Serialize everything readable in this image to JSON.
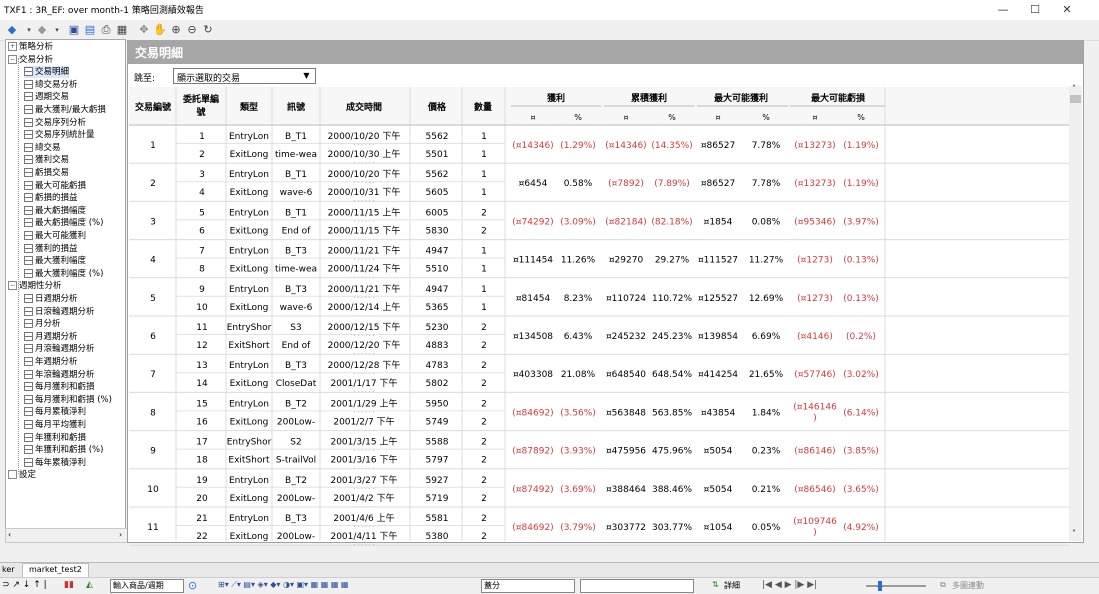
{
  "window": {
    "title": "TXF1 : 3R_EF: over month-1 策略回測績效報告",
    "controls": {
      "minimize": "—",
      "maximize": "☐",
      "close": "✕"
    }
  },
  "toolbar": {
    "icons": [
      "back-icon",
      "forward-icon",
      "save-icon",
      "doc-icon",
      "print-icon",
      "toggle-icon",
      "pointer-icon",
      "hand-icon",
      "zoom-in-icon",
      "zoom-out-icon",
      "refresh-icon"
    ]
  },
  "tree": {
    "nodes": [
      {
        "label": "策略分析",
        "level": 0,
        "box": "⊞",
        "selected": false
      },
      {
        "label": "交易分析",
        "level": 0,
        "box": "⊟",
        "selected": false
      },
      {
        "label": "交易明細",
        "level": 1,
        "selected": true
      },
      {
        "label": "總交易分析",
        "level": 1,
        "selected": false
      },
      {
        "label": "週期交易",
        "level": 1,
        "selected": false
      },
      {
        "label": "最大獲利/最大虧損",
        "level": 1,
        "selected": false
      },
      {
        "label": "交易序列分析",
        "level": 1,
        "selected": false
      },
      {
        "label": "交易序列統計量",
        "level": 1,
        "selected": false
      },
      {
        "label": "總交易",
        "level": 1,
        "selected": false
      },
      {
        "label": "獲利交易",
        "level": 1,
        "selected": false
      },
      {
        "label": "虧損交易",
        "level": 1,
        "selected": false
      },
      {
        "label": "最大可能虧損",
        "level": 1,
        "selected": false
      },
      {
        "label": "虧損的損益",
        "level": 1,
        "selected": false
      },
      {
        "label": "最大虧損幅度",
        "level": 1,
        "selected": false
      },
      {
        "label": "最大虧損幅度 (%)",
        "level": 1,
        "selected": false
      },
      {
        "label": "最大可能獲利",
        "level": 1,
        "selected": false
      },
      {
        "label": "獲利的損益",
        "level": 1,
        "selected": false
      },
      {
        "label": "最大獲利幅度",
        "level": 1,
        "selected": false
      },
      {
        "label": "最大獲利幅度 (%)",
        "level": 1,
        "selected": false
      },
      {
        "label": "週期性分析",
        "level": 0,
        "box": "⊟",
        "selected": false
      },
      {
        "label": "日週期分析",
        "level": 1,
        "selected": false
      },
      {
        "label": "日滾輪週期分析",
        "level": 1,
        "selected": false
      },
      {
        "label": "月分析",
        "level": 1,
        "selected": false
      },
      {
        "label": "月週期分析",
        "level": 1,
        "selected": false
      },
      {
        "label": "月滾輪週期分析",
        "level": 1,
        "selected": false
      },
      {
        "label": "年週期分析",
        "level": 1,
        "selected": false
      },
      {
        "label": "年滾輪週期分析",
        "level": 1,
        "selected": false
      },
      {
        "label": "每月獲利和虧損",
        "level": 1,
        "selected": false
      },
      {
        "label": "每月獲利和虧損 (%)",
        "level": 1,
        "selected": false
      },
      {
        "label": "每月累積淨利",
        "level": 1,
        "selected": false
      },
      {
        "label": "每月平均獲利",
        "level": 1,
        "selected": false
      },
      {
        "label": "年獲利和虧損",
        "level": 1,
        "selected": false
      },
      {
        "label": "年獲利和虧損 (%)",
        "level": 1,
        "selected": false
      },
      {
        "label": "每年累積淨利",
        "level": 1,
        "selected": false
      },
      {
        "label": "設定",
        "level": 0,
        "box": "",
        "selected": false
      }
    ]
  },
  "panel": {
    "title": "交易明細",
    "jump_label": "跳至:",
    "jump_value": "顯示選取的交易",
    "headers": {
      "trade_no": "交易編號",
      "order_no": "委託單編號",
      "type": "類型",
      "signal": "訊號",
      "time": "成交時間",
      "price": "價格",
      "qty": "數量",
      "profit": "獲利",
      "cum_profit": "累積獲利",
      "max_profit": "最大可能獲利",
      "max_loss": "最大可能虧損",
      "currency": "¤",
      "percent": "%"
    },
    "trades": [
      {
        "no": "1",
        "orders": [
          {
            "n": "1",
            "type": "EntryLon",
            "signal": "B_T1",
            "time": "2000/10/20 下午",
            "price": "5562",
            "qty": "1"
          },
          {
            "n": "2",
            "type": "ExitLong",
            "signal": "time-wea",
            "time": "2000/10/30 上午",
            "price": "5501",
            "qty": "1"
          }
        ],
        "profit": "(¤14346)",
        "profit_pct": "(1.29%)",
        "cum": "(¤14346)",
        "cum_pct": "(14.35%)",
        "maxp": "¤86527",
        "maxp_pct": "7.78%",
        "maxl": "(¤13273)",
        "maxl_pct": "(1.19%)"
      },
      {
        "no": "2",
        "orders": [
          {
            "n": "3",
            "type": "EntryLon",
            "signal": "B_T1",
            "time": "2000/10/20 下午",
            "price": "5562",
            "qty": "1"
          },
          {
            "n": "4",
            "type": "ExitLong",
            "signal": "wave-6",
            "time": "2000/10/31 下午",
            "price": "5605",
            "qty": "1"
          }
        ],
        "profit": "¤6454",
        "profit_pct": "0.58%",
        "cum": "(¤7892)",
        "cum_pct": "(7.89%)",
        "maxp": "¤86527",
        "maxp_pct": "7.78%",
        "maxl": "(¤13273)",
        "maxl_pct": "(1.19%)"
      },
      {
        "no": "3",
        "orders": [
          {
            "n": "5",
            "type": "EntryLon",
            "signal": "B_T1",
            "time": "2000/11/15 上午",
            "price": "6005",
            "qty": "2"
          },
          {
            "n": "6",
            "type": "ExitLong",
            "signal": "End of",
            "time": "2000/11/15 下午",
            "price": "5830",
            "qty": "2"
          }
        ],
        "profit": "(¤74292)",
        "profit_pct": "(3.09%)",
        "cum": "(¤82184)",
        "cum_pct": "(82.18%)",
        "maxp": "¤1854",
        "maxp_pct": "0.08%",
        "maxl": "(¤95346)",
        "maxl_pct": "(3.97%)"
      },
      {
        "no": "4",
        "orders": [
          {
            "n": "7",
            "type": "EntryLon",
            "signal": "B_T3",
            "time": "2000/11/21 下午",
            "price": "4947",
            "qty": "1"
          },
          {
            "n": "8",
            "type": "ExitLong",
            "signal": "time-wea",
            "time": "2000/11/24 下午",
            "price": "5510",
            "qty": "1"
          }
        ],
        "profit": "¤111454",
        "profit_pct": "11.26%",
        "cum": "¤29270",
        "cum_pct": "29.27%",
        "maxp": "¤111527",
        "maxp_pct": "11.27%",
        "maxl": "(¤1273)",
        "maxl_pct": "(0.13%)"
      },
      {
        "no": "5",
        "orders": [
          {
            "n": "9",
            "type": "EntryLon",
            "signal": "B_T3",
            "time": "2000/11/21 下午",
            "price": "4947",
            "qty": "1"
          },
          {
            "n": "10",
            "type": "ExitLong",
            "signal": "wave-6",
            "time": "2000/12/14 上午",
            "price": "5365",
            "qty": "1"
          }
        ],
        "profit": "¤81454",
        "profit_pct": "8.23%",
        "cum": "¤110724",
        "cum_pct": "110.72%",
        "maxp": "¤125527",
        "maxp_pct": "12.69%",
        "maxl": "(¤1273)",
        "maxl_pct": "(0.13%)"
      },
      {
        "no": "6",
        "orders": [
          {
            "n": "11",
            "type": "EntryShor",
            "signal": "S3",
            "time": "2000/12/15 下午",
            "price": "5230",
            "qty": "2"
          },
          {
            "n": "12",
            "type": "ExitShort",
            "signal": "End of",
            "time": "2000/12/20 下午",
            "price": "4883",
            "qty": "2"
          }
        ],
        "profit": "¤134508",
        "profit_pct": "6.43%",
        "cum": "¤245232",
        "cum_pct": "245.23%",
        "maxp": "¤139854",
        "maxp_pct": "6.69%",
        "maxl": "(¤4146)",
        "maxl_pct": "(0.2%)"
      },
      {
        "no": "7",
        "orders": [
          {
            "n": "13",
            "type": "EntryLon",
            "signal": "B_T3",
            "time": "2000/12/28 下午",
            "price": "4783",
            "qty": "2"
          },
          {
            "n": "14",
            "type": "ExitLong",
            "signal": "CloseDat",
            "time": "2001/1/17 下午",
            "price": "5802",
            "qty": "2"
          }
        ],
        "profit": "¤403308",
        "profit_pct": "21.08%",
        "cum": "¤648540",
        "cum_pct": "648.54%",
        "maxp": "¤414254",
        "maxp_pct": "21.65%",
        "maxl": "(¤57746)",
        "maxl_pct": "(3.02%)"
      },
      {
        "no": "8",
        "orders": [
          {
            "n": "15",
            "type": "EntryLon",
            "signal": "B_T2",
            "time": "2001/1/29 上午",
            "price": "5950",
            "qty": "2"
          },
          {
            "n": "16",
            "type": "ExitLong",
            "signal": "200Low-",
            "time": "2001/2/7 下午",
            "price": "5749",
            "qty": "2"
          }
        ],
        "profit": "(¤84692)",
        "profit_pct": "(3.56%)",
        "cum": "¤563848",
        "cum_pct": "563.85%",
        "maxp": "¤43854",
        "maxp_pct": "1.84%",
        "maxl": "(¤146146",
        "maxl2": ")",
        "maxl_pct": "(6.14%)"
      },
      {
        "no": "9",
        "orders": [
          {
            "n": "17",
            "type": "EntryShor",
            "signal": "S2",
            "time": "2001/3/15 上午",
            "price": "5588",
            "qty": "2"
          },
          {
            "n": "18",
            "type": "ExitShort",
            "signal": "S-trailVol",
            "time": "2001/3/16 下午",
            "price": "5797",
            "qty": "2"
          }
        ],
        "profit": "(¤87892)",
        "profit_pct": "(3.93%)",
        "cum": "¤475956",
        "cum_pct": "475.96%",
        "maxp": "¤5054",
        "maxp_pct": "0.23%",
        "maxl": "(¤86146)",
        "maxl_pct": "(3.85%)"
      },
      {
        "no": "10",
        "orders": [
          {
            "n": "19",
            "type": "EntryLon",
            "signal": "B_T2",
            "time": "2001/3/27 下午",
            "price": "5927",
            "qty": "2"
          },
          {
            "n": "20",
            "type": "ExitLong",
            "signal": "200Low-",
            "time": "2001/4/2 下午",
            "price": "5719",
            "qty": "2"
          }
        ],
        "profit": "(¤87492)",
        "profit_pct": "(3.69%)",
        "cum": "¤388464",
        "cum_pct": "388.46%",
        "maxp": "¤5054",
        "maxp_pct": "0.21%",
        "maxl": "(¤86546)",
        "maxl_pct": "(3.65%)"
      },
      {
        "no": "11",
        "orders": [
          {
            "n": "21",
            "type": "EntryLon",
            "signal": "B_T3",
            "time": "2001/4/6 上午",
            "price": "5581",
            "qty": "2"
          },
          {
            "n": "22",
            "type": "ExitLong",
            "signal": "200Low-",
            "time": "2001/4/11 下午",
            "price": "5380",
            "qty": "2"
          }
        ],
        "profit": "(¤84692)",
        "profit_pct": "(3.79%)",
        "cum": "¤303772",
        "cum_pct": "303.77%",
        "maxp": "¤1054",
        "maxp_pct": "0.05%",
        "maxl": "(¤109746",
        "maxl2": ")",
        "maxl_pct": "(4.92%)"
      }
    ]
  },
  "tabs": {
    "tab1": "ker",
    "tab2": "market_test2"
  },
  "bottom": {
    "product_placeholder": "輸入商品/週期",
    "field_value": "蓋分",
    "detail_label": "詳細",
    "sync_label": "多圖連動"
  },
  "colors": {
    "negative": "#d23c3c",
    "header_bg": "#a6a6a6",
    "selected": "#dbe8f7"
  }
}
